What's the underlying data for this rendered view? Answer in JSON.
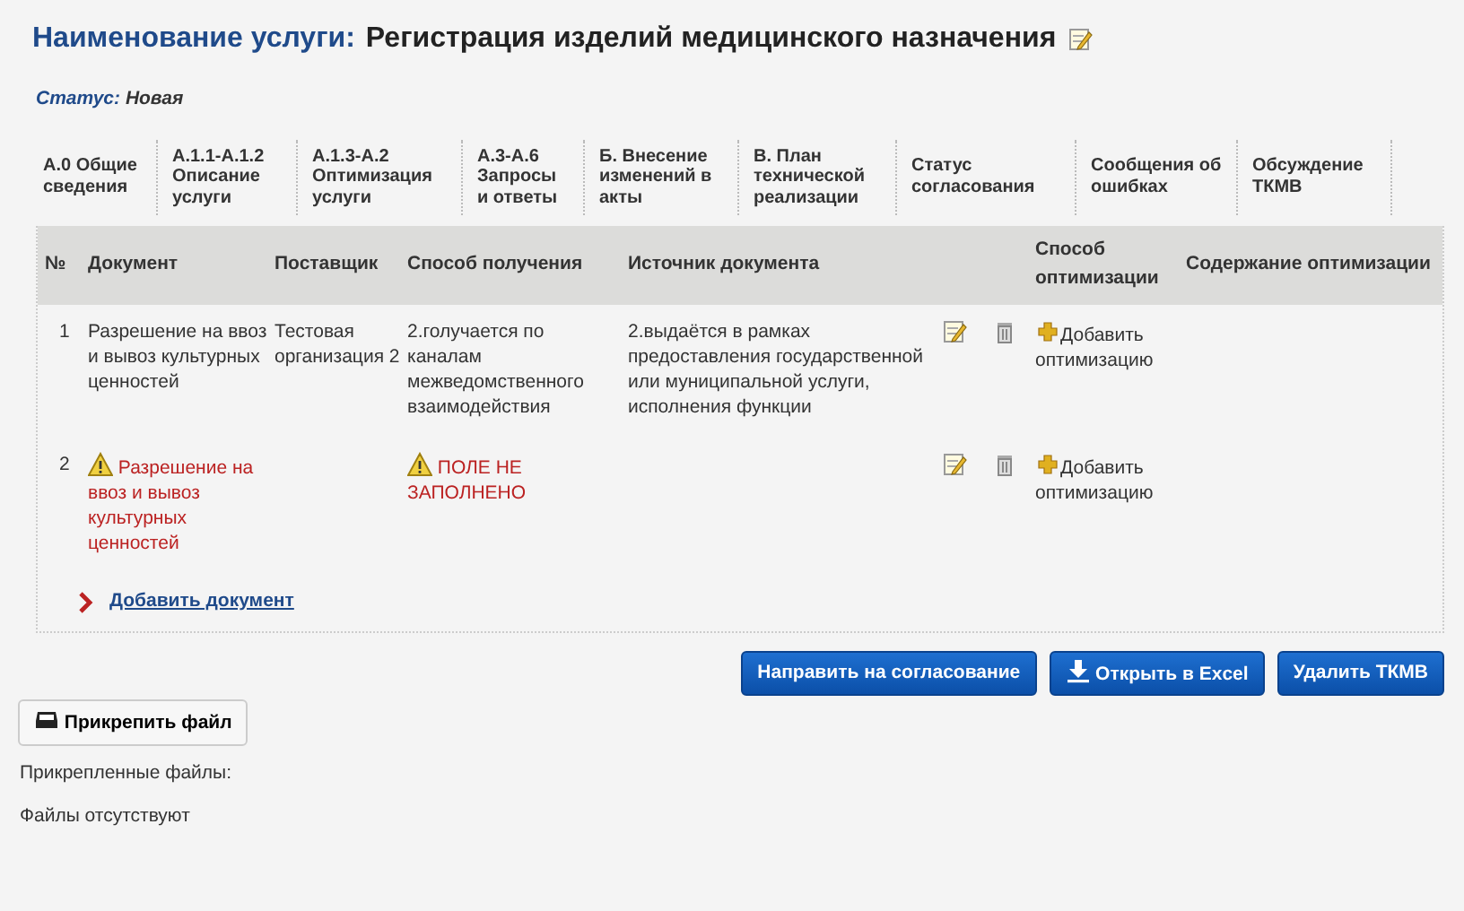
{
  "title": {
    "label": "Наименование услуги:",
    "value": "Регистрация изделий медицинского назначения"
  },
  "status": {
    "label": "Статус:",
    "value": "Новая"
  },
  "tabs": [
    {
      "label": "А.0 Общие сведения",
      "selected": false
    },
    {
      "label": "А.1.1-А.1.2 Описание услуги",
      "selected": false
    },
    {
      "label": "А.1.3-А.2 Оптимизация услуги",
      "selected": false
    },
    {
      "label": "А.3-А.6 Запросы и ответы",
      "selected": false
    },
    {
      "label": "Б. Внесение изменений в акты",
      "selected": false
    },
    {
      "label": "В. План технической реализации",
      "selected": false
    },
    {
      "label": "Статус согласования",
      "selected": false
    },
    {
      "label": "Сообщения об ошибках",
      "selected": false
    },
    {
      "label": "Обсуждение ТКМВ",
      "selected": false
    }
  ],
  "table": {
    "columns": [
      "№",
      "Документ",
      "Поставщик",
      "Способ получения",
      "Источник документа",
      "Способ оптимизации",
      "Содержание оптимизации"
    ],
    "rows": [
      {
        "number": "1",
        "document": {
          "text": "Разрешение на ввоз и вывоз культурных ценностей",
          "warning": false
        },
        "supplier": {
          "text": "Тестовая организация 2",
          "warning": false
        },
        "method": {
          "text": "2.голучается по каналам межведомственного взаимодействия",
          "warning": false
        },
        "source": {
          "text": "2.выдаётся в рамках предоставления государственной или муниципальной услуги, исполнения функции",
          "warning": false
        },
        "optimization_action": "Добавить оптимизацию"
      },
      {
        "number": "2",
        "document": {
          "text": "Разрешение на ввоз и вывоз культурных ценностей",
          "warning": true
        },
        "method": {
          "text": "ПОЛЕ НЕ ЗАПОЛНЕНО",
          "warning": true
        },
        "optimization_action": "Добавить оптимизацию"
      }
    ],
    "add_link": "Добавить документ"
  },
  "buttons": [
    "Направить на согласование",
    "Открыть в Excel",
    "Удалить ТКМВ"
  ],
  "attach_button": "Прикрепить файл",
  "attached_label": "Прикрепленные файлы:",
  "attached_empty": "Файлы отсутствуют"
}
